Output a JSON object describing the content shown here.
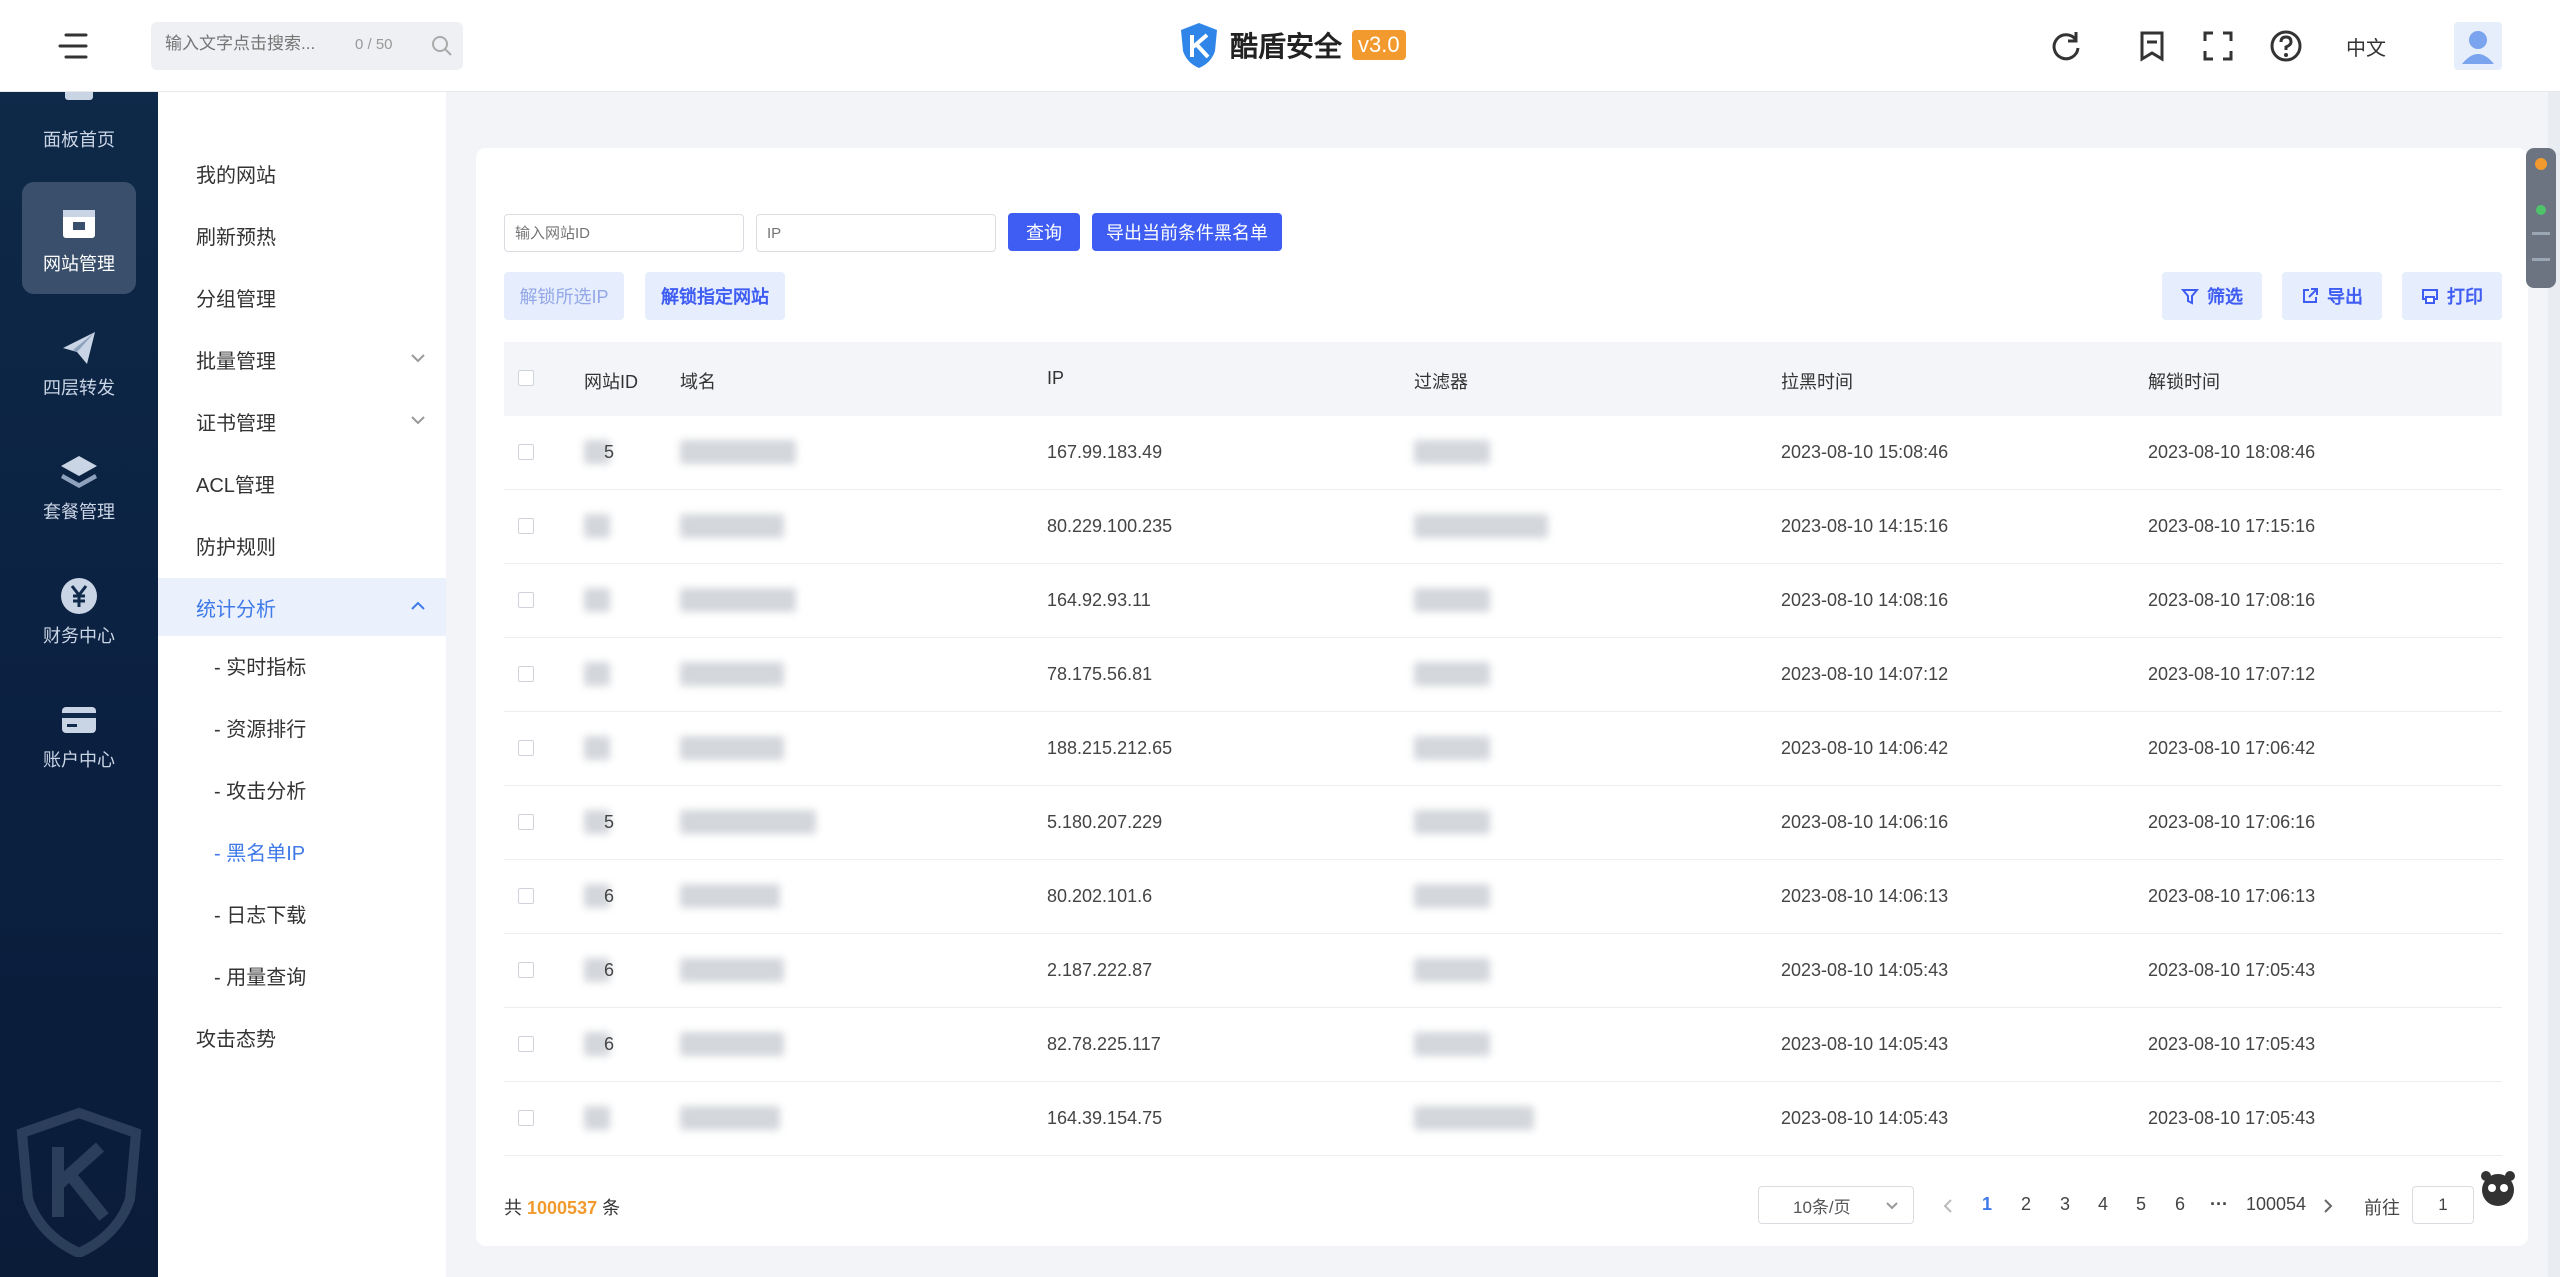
{
  "header": {
    "search_placeholder": "输入文字点击搜索...",
    "search_count": "0 / 50",
    "brand_title": "酷盾安全",
    "brand_version": "v3.0",
    "language": "中文"
  },
  "rail": {
    "items": [
      {
        "label": "面板首页",
        "icon": "dashboard-icon"
      },
      {
        "label": "网站管理",
        "icon": "website-icon",
        "active": true
      },
      {
        "label": "四层转发",
        "icon": "paper-plane-icon"
      },
      {
        "label": "套餐管理",
        "icon": "layers-icon"
      },
      {
        "label": "财务中心",
        "icon": "yuan-icon"
      },
      {
        "label": "账户中心",
        "icon": "card-icon"
      }
    ]
  },
  "subside": {
    "items": [
      {
        "label": "我的网站"
      },
      {
        "label": "刷新预热"
      },
      {
        "label": "分组管理"
      },
      {
        "label": "批量管理"
      },
      {
        "label": "证书管理"
      },
      {
        "label": "ACL管理"
      },
      {
        "label": "防护规则"
      },
      {
        "label": "统计分析"
      }
    ],
    "children": [
      {
        "label": "- 实时指标"
      },
      {
        "label": "- 资源排行"
      },
      {
        "label": "- 攻击分析"
      },
      {
        "label": "- 黑名单IP"
      },
      {
        "label": "- 日志下载"
      },
      {
        "label": "- 用量查询"
      }
    ],
    "last_item": "攻击态势"
  },
  "filters": {
    "site_id_placeholder": "输入网站ID",
    "ip_placeholder": "IP",
    "query_label": "查询",
    "export_blacklist_label": "导出当前条件黑名单",
    "unlock_selected_label": "解锁所选IP",
    "unlock_site_label": "解锁指定网站",
    "filter_label": "筛选",
    "export_label": "导出",
    "print_label": "打印"
  },
  "table": {
    "headers": [
      "网站ID",
      "域名",
      "IP",
      "过滤器",
      "拉黑时间",
      "解锁时间"
    ],
    "rows": [
      {
        "id_frag": "5",
        "ip": "167.99.183.49",
        "blocked": "2023-08-10 15:08:46",
        "unlock": "2023-08-10 18:08:46"
      },
      {
        "id_frag": "",
        "ip": "80.229.100.235",
        "blocked": "2023-08-10 14:15:16",
        "unlock": "2023-08-10 17:15:16"
      },
      {
        "id_frag": "",
        "ip": "164.92.93.11",
        "blocked": "2023-08-10 14:08:16",
        "unlock": "2023-08-10 17:08:16"
      },
      {
        "id_frag": "",
        "ip": "78.175.56.81",
        "blocked": "2023-08-10 14:07:12",
        "unlock": "2023-08-10 17:07:12"
      },
      {
        "id_frag": "",
        "ip": "188.215.212.65",
        "blocked": "2023-08-10 14:06:42",
        "unlock": "2023-08-10 17:06:42"
      },
      {
        "id_frag": "5",
        "ip": "5.180.207.229",
        "blocked": "2023-08-10 14:06:16",
        "unlock": "2023-08-10 17:06:16"
      },
      {
        "id_frag": "6",
        "ip": "80.202.101.6",
        "blocked": "2023-08-10 14:06:13",
        "unlock": "2023-08-10 17:06:13"
      },
      {
        "id_frag": "6",
        "ip": "2.187.222.87",
        "blocked": "2023-08-10 14:05:43",
        "unlock": "2023-08-10 17:05:43"
      },
      {
        "id_frag": "6",
        "ip": "82.78.225.117",
        "blocked": "2023-08-10 14:05:43",
        "unlock": "2023-08-10 17:05:43"
      },
      {
        "id_frag": "",
        "ip": "164.39.154.75",
        "blocked": "2023-08-10 14:05:43",
        "unlock": "2023-08-10 17:05:43"
      }
    ]
  },
  "pagination": {
    "total_prefix": "共",
    "total": "1000537",
    "total_suffix": "条",
    "page_size": "10条/页",
    "pages": [
      "1",
      "2",
      "3",
      "4",
      "5",
      "6"
    ],
    "ellipsis": "···",
    "last_page": "100054",
    "goto_label": "前往",
    "goto_value": "1"
  },
  "colors": {
    "accent": "#3f5df2",
    "link": "#3f7ae8",
    "rail_bg": "#0f2a4a",
    "version_badge": "#f29a2e"
  }
}
